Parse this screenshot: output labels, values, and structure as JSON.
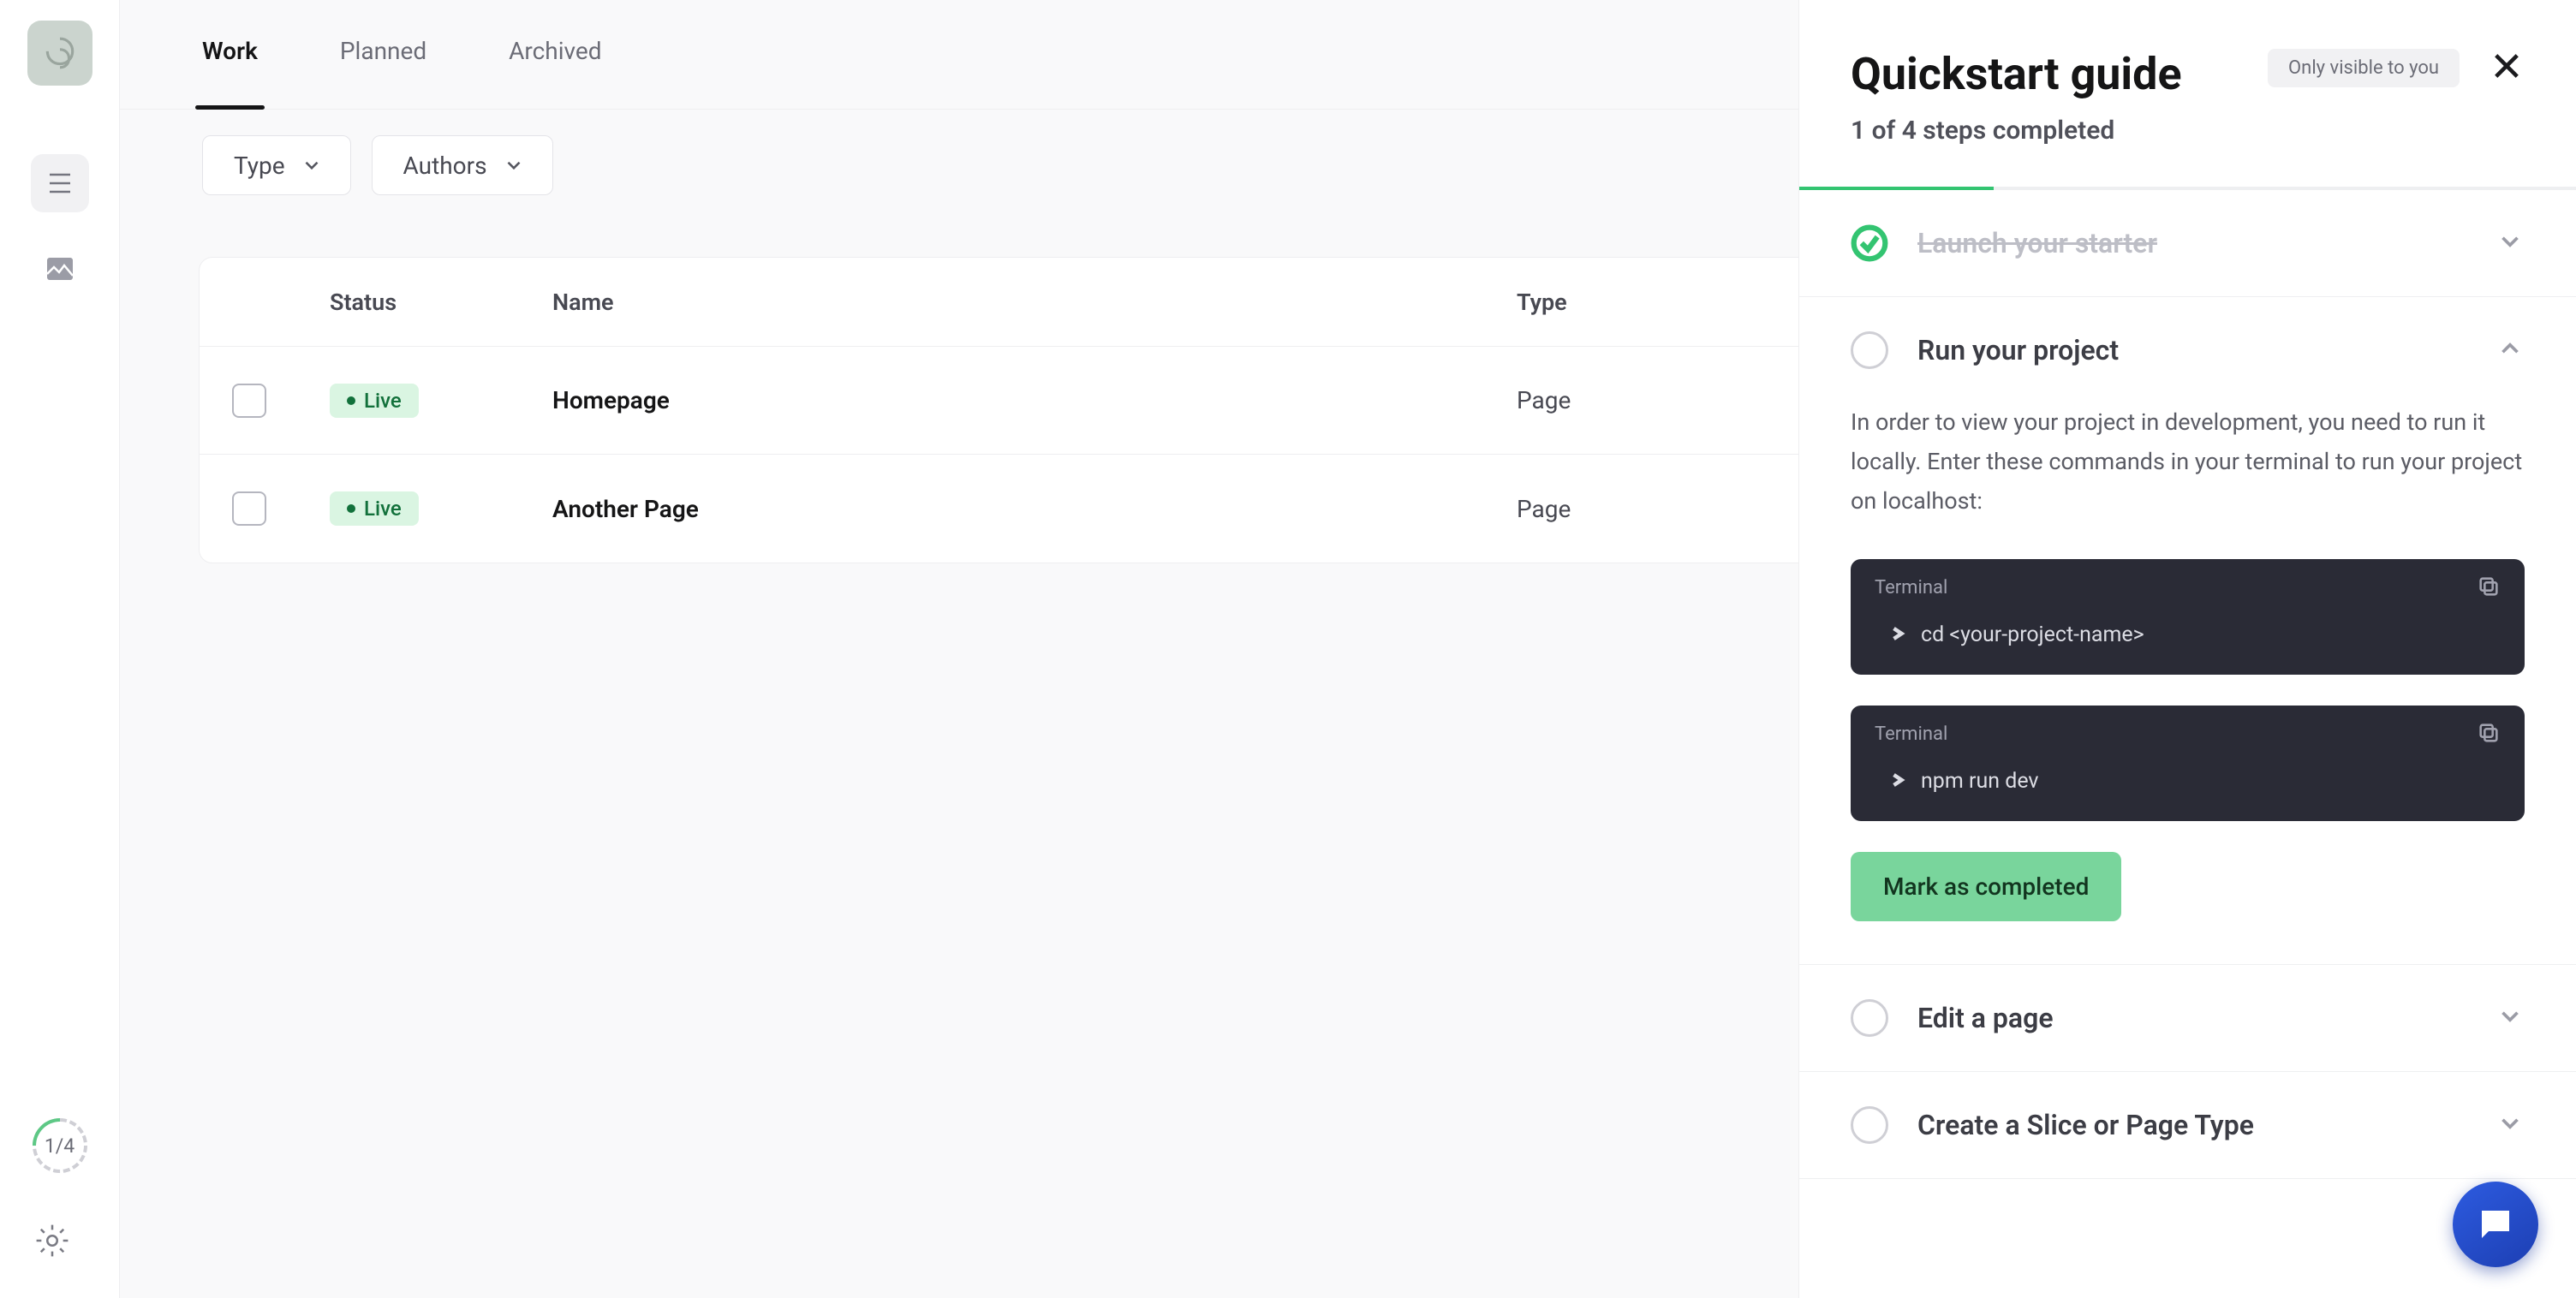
{
  "nav": {
    "progress_label": "1/4"
  },
  "tabs": {
    "work": "Work",
    "planned": "Planned",
    "archived": "Archived"
  },
  "filters": {
    "type": "Type",
    "authors": "Authors"
  },
  "table": {
    "head": {
      "status": "Status",
      "name": "Name",
      "type": "Type"
    },
    "rows": [
      {
        "status": "Live",
        "name": "Homepage",
        "type": "Page"
      },
      {
        "status": "Live",
        "name": "Another Page",
        "type": "Page"
      }
    ]
  },
  "panel": {
    "title": "Quickstart guide",
    "subtitle": "1 of 4 steps completed",
    "visibility_pill": "Only visible to you"
  },
  "steps": {
    "s1_title": "Launch your starter",
    "s2_title": "Run your project",
    "s2_desc": "In order to view your project in development, you need to run it locally. Enter these commands in your terminal to run your project on localhost:",
    "terminal_label": "Terminal",
    "cmd1": "cd <your-project-name>",
    "cmd2": "npm run dev",
    "mark_complete": "Mark as completed",
    "s3_title": "Edit a page",
    "s4_title": "Create a Slice or Page Type"
  }
}
